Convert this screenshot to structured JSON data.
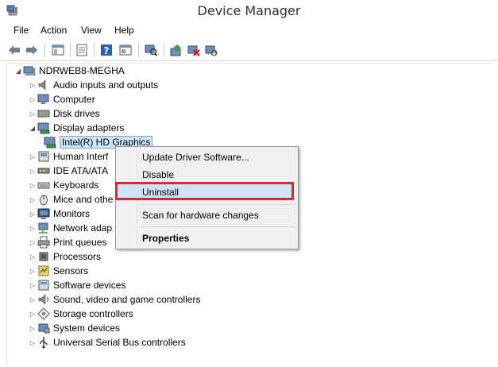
{
  "window": {
    "title": "Device Manager"
  },
  "menu": [
    "File",
    "Action",
    "View",
    "Help"
  ],
  "toolbar": {
    "buttons": [
      "back-arrow-icon",
      "forward-arrow-icon",
      "show-hide-tree-icon",
      "properties-icon",
      "help-icon",
      "view-icon",
      "scan-hardware-icon",
      "update-driver-icon",
      "uninstall-icon",
      "enable-device-icon"
    ]
  },
  "tree": {
    "root": "NDRWEB8-MEGHA",
    "items": [
      {
        "label": "Audio inputs and outputs",
        "icon": "speaker-icon"
      },
      {
        "label": "Computer",
        "icon": "computer-icon"
      },
      {
        "label": "Disk drives",
        "icon": "disk-icon"
      },
      {
        "label": "Display adapters",
        "icon": "display-adapter-icon",
        "expanded": true
      },
      {
        "label": "Intel(R) HD Graphics",
        "icon": "display-adapter-icon",
        "child": true,
        "selected": true
      },
      {
        "label": "Human Interf",
        "icon": "hid-icon"
      },
      {
        "label": "IDE ATA/ATA",
        "icon": "ide-icon"
      },
      {
        "label": "Keyboards",
        "icon": "keyboard-icon"
      },
      {
        "label": "Mice and othe",
        "icon": "mouse-icon"
      },
      {
        "label": "Monitors",
        "icon": "monitor-icon"
      },
      {
        "label": "Network adap",
        "icon": "network-icon"
      },
      {
        "label": "Print queues",
        "icon": "printer-icon"
      },
      {
        "label": "Processors",
        "icon": "processor-icon"
      },
      {
        "label": "Sensors",
        "icon": "sensor-icon"
      },
      {
        "label": "Software devices",
        "icon": "software-icon"
      },
      {
        "label": "Sound, video and game controllers",
        "icon": "sound-icon"
      },
      {
        "label": "Storage controllers",
        "icon": "storage-icon"
      },
      {
        "label": "System devices",
        "icon": "system-icon"
      },
      {
        "label": "Universal Serial Bus controllers",
        "icon": "usb-icon"
      }
    ]
  },
  "context_menu": {
    "items": [
      {
        "label": "Update Driver Software..."
      },
      {
        "label": "Disable"
      },
      {
        "label": "Uninstall",
        "highlighted": true
      },
      {
        "label": "Scan for hardware changes"
      },
      {
        "label": "Properties",
        "bold": true
      }
    ]
  },
  "colors": {
    "highlight": "#cce4f7",
    "annotation": "#e2262e"
  }
}
